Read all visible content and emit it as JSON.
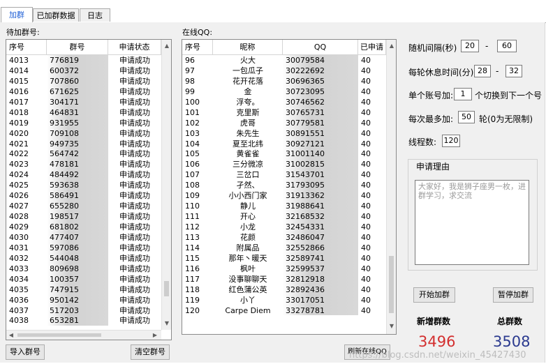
{
  "tabs": [
    "加群",
    "已加群数据",
    "日志"
  ],
  "pending": {
    "title": "待加群号:",
    "headers": [
      "序号",
      "群号",
      "申请状态"
    ],
    "rows": [
      [
        "4013",
        "776819",
        "申请成功"
      ],
      [
        "4014",
        "600372",
        "申请成功"
      ],
      [
        "4015",
        "707860",
        "申请成功"
      ],
      [
        "4016",
        "671625",
        "申请成功"
      ],
      [
        "4017",
        "304171",
        "申请成功"
      ],
      [
        "4018",
        "464831",
        "申请成功"
      ],
      [
        "4019",
        "931955",
        "申请成功"
      ],
      [
        "4020",
        "709108",
        "申请成功"
      ],
      [
        "4021",
        "949735",
        "申请成功"
      ],
      [
        "4022",
        "564742",
        "申请成功"
      ],
      [
        "4023",
        "478181",
        "申请成功"
      ],
      [
        "4024",
        "484492",
        "申请成功"
      ],
      [
        "4025",
        "593638",
        "申请成功"
      ],
      [
        "4026",
        "586491",
        "申请成功"
      ],
      [
        "4027",
        "655280",
        "申请成功"
      ],
      [
        "4028",
        "198517",
        "申请成功"
      ],
      [
        "4029",
        "681802",
        "申请成功"
      ],
      [
        "4030",
        "477407",
        "申请成功"
      ],
      [
        "4031",
        "597086",
        "申请成功"
      ],
      [
        "4032",
        "544048",
        "申请成功"
      ],
      [
        "4033",
        "809698",
        "申请成功"
      ],
      [
        "4034",
        "100357",
        "申请成功"
      ],
      [
        "4035",
        "747915",
        "申请成功"
      ],
      [
        "4036",
        "950142",
        "申请成功"
      ],
      [
        "4037",
        "517203",
        "申请成功"
      ],
      [
        "4038",
        "653281",
        "申请成功"
      ]
    ]
  },
  "online": {
    "title": "在线QQ:",
    "headers": [
      "序号",
      "昵称",
      "QQ",
      "已申请"
    ],
    "rows": [
      [
        "96",
        "火大",
        "30079584",
        "40"
      ],
      [
        "97",
        "一包瓜子",
        "30222692",
        "40"
      ],
      [
        "98",
        "花开花落",
        "30696365",
        "40"
      ],
      [
        "99",
        "金",
        "30723095",
        "40"
      ],
      [
        "100",
        "浮夸。",
        "30746562",
        "40"
      ],
      [
        "101",
        "克里斯",
        "30765731",
        "40"
      ],
      [
        "102",
        "虎哥",
        "30779581",
        "40"
      ],
      [
        "103",
        "朱先生",
        "30891551",
        "40"
      ],
      [
        "104",
        "夏至北纬",
        "30927121",
        "40"
      ],
      [
        "105",
        "黄雀雀",
        "31001140",
        "40"
      ],
      [
        "106",
        "三分微凉",
        "31002815",
        "40"
      ],
      [
        "107",
        "三岔口",
        "31543701",
        "40"
      ],
      [
        "108",
        "孑然、",
        "31793095",
        "40"
      ],
      [
        "109",
        "小小西门家",
        "31913362",
        "40"
      ],
      [
        "110",
        "静儿",
        "31988641",
        "40"
      ],
      [
        "111",
        "开心",
        "32168532",
        "40"
      ],
      [
        "112",
        "小龙",
        "32454331",
        "40"
      ],
      [
        "113",
        "花颜",
        "32486047",
        "40"
      ],
      [
        "114",
        "附属品",
        "32552866",
        "40"
      ],
      [
        "115",
        "那年丶暖天",
        "32589741",
        "40"
      ],
      [
        "116",
        "枫叶",
        "32599537",
        "40"
      ],
      [
        "117",
        "没事聊聊天",
        "32812918",
        "40"
      ],
      [
        "118",
        "红色蒲公英",
        "32892436",
        "40"
      ],
      [
        "119",
        "小丫",
        "33017051",
        "40"
      ],
      [
        "120",
        "Carpe Diem",
        "33278781",
        "40"
      ]
    ]
  },
  "settings": {
    "interval_label": "随机间隔(秒)",
    "interval_min": "20",
    "interval_max": "60",
    "rest_label": "每轮休息时间(分)",
    "rest_min": "28",
    "rest_max": "32",
    "dash": "-",
    "switch_pre": "单个账号加:",
    "switch_val": "1",
    "switch_post": "个切换到下一个号",
    "max_pre": "每次最多加:",
    "max_val": "50",
    "max_post": "轮(0为无限制)",
    "threads_label": "线程数:",
    "threads_val": "120"
  },
  "reason": {
    "title": "申请理由",
    "text": "大家好，我是狮子座男一枚，进群学习，求交流"
  },
  "buttons": {
    "start": "开始加群",
    "pause": "暂停加群",
    "import": "导入群号",
    "clear": "清空群号",
    "refresh": "刷新在线QQ"
  },
  "stats": {
    "new_label": "新增群数",
    "new_value": "3496",
    "total_label": "总群数",
    "total_value": "3508",
    "new_color": "#d32f2f",
    "total_color": "#2b3a8f"
  },
  "watermark": "https://blog.csdn.net/weixin_45427430"
}
